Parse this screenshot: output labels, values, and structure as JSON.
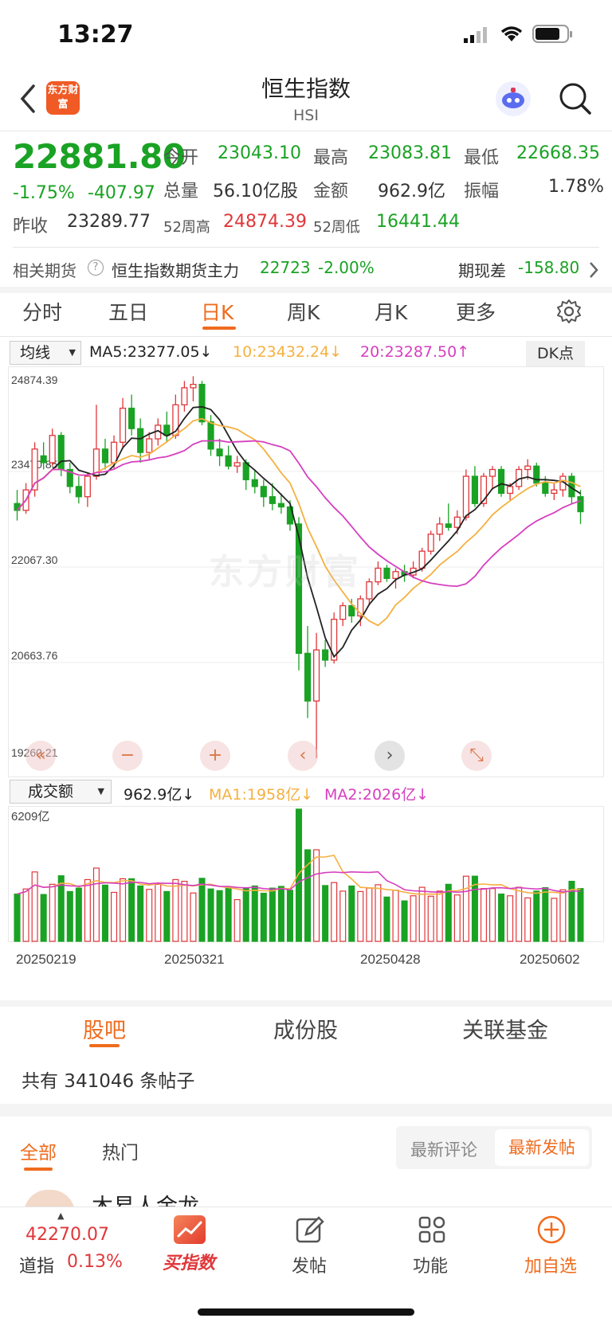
{
  "status": {
    "time": "13:27"
  },
  "header": {
    "title": "恒生指数",
    "subtitle": "HSI",
    "logo_text": "东方财富"
  },
  "quote": {
    "price": "22881.80",
    "change_pct": "-1.75%",
    "change": "-407.97",
    "open_label": "今开",
    "open": "23043.10",
    "high_label": "最高",
    "high": "23083.81",
    "low_label": "最低",
    "low": "22668.35",
    "volume_label": "总量",
    "volume": "56.10亿股",
    "amount_label": "金额",
    "amount": "962.9亿",
    "amplitude_label": "振幅",
    "amplitude": "1.78%",
    "prev_close_label": "昨收",
    "prev_close": "23289.77",
    "wk52_high_label": "52周高",
    "wk52_high": "24874.39",
    "wk52_low_label": "52周低",
    "wk52_low": "16441.44"
  },
  "futures": {
    "label": "相关期货",
    "name": "恒生指数期货主力",
    "price": "22723",
    "pct": "-2.00%",
    "basis_label": "期现差",
    "basis": "-158.80"
  },
  "chart_tabs": [
    "分时",
    "五日",
    "日K",
    "周K",
    "月K",
    "更多"
  ],
  "active_chart_tab": "日K",
  "kline": {
    "indicator_select": "均线",
    "ma5": "MA5:23277.05↓",
    "ma10": "10:23432.24↓",
    "ma20": "20:23287.50↑",
    "dk_button": "DK点",
    "watermark": "东方财富",
    "y_labels": [
      "24874.39",
      "23470.85",
      "22067.30",
      "20663.76",
      "19260.21"
    ],
    "volume_select": "成交额",
    "vol_value": "962.9亿↓",
    "vol_ma1": "MA1:1958亿↓",
    "vol_ma2": "MA2:2026亿↓",
    "vol_max_label": "6209亿",
    "x_labels": [
      "20250219",
      "20250321",
      "20250428",
      "20250602"
    ]
  },
  "chart_data": {
    "type": "candlestick",
    "ylim": [
      19260.21,
      24874.39
    ],
    "colors": {
      "up": "#e0373a",
      "down": "#1aa224",
      "ma5": "#222222",
      "ma10": "#f5b041",
      "ma20": "#d63fbf"
    },
    "candles": [
      [
        23000,
        23200,
        22750,
        22900
      ],
      [
        22900,
        23300,
        22850,
        23200
      ],
      [
        23200,
        23900,
        23100,
        23800
      ],
      [
        23700,
        23900,
        23500,
        23600
      ],
      [
        23600,
        24100,
        23550,
        24000
      ],
      [
        24000,
        24050,
        23400,
        23500
      ],
      [
        23500,
        23600,
        23150,
        23250
      ],
      [
        23250,
        23400,
        23000,
        23100
      ],
      [
        23100,
        23450,
        22950,
        23400
      ],
      [
        23400,
        24450,
        23350,
        23800
      ],
      [
        23800,
        23950,
        23500,
        23600
      ],
      [
        23600,
        24000,
        23500,
        23900
      ],
      [
        23900,
        24550,
        23800,
        24400
      ],
      [
        24400,
        24600,
        24000,
        24100
      ],
      [
        24100,
        24250,
        23600,
        23750
      ],
      [
        23750,
        24050,
        23650,
        23950
      ],
      [
        23950,
        24250,
        23850,
        24150
      ],
      [
        24150,
        24350,
        23900,
        24000
      ],
      [
        24000,
        24600,
        23950,
        24450
      ],
      [
        24450,
        24800,
        24350,
        24700
      ],
      [
        24700,
        24870,
        24500,
        24750
      ],
      [
        24750,
        24800,
        24150,
        24200
      ],
      [
        24200,
        24300,
        23700,
        23800
      ],
      [
        23800,
        23950,
        23550,
        23700
      ],
      [
        23700,
        23850,
        23500,
        23550
      ],
      [
        23550,
        23700,
        23450,
        23600
      ],
      [
        23600,
        23650,
        23200,
        23350
      ],
      [
        23350,
        23500,
        23150,
        23250
      ],
      [
        23250,
        23350,
        22950,
        23100
      ],
      [
        23100,
        23300,
        22900,
        23000
      ],
      [
        23000,
        23150,
        22850,
        22950
      ],
      [
        22950,
        23050,
        22600,
        22700
      ],
      [
        22700,
        22800,
        20550,
        20800
      ],
      [
        20800,
        21200,
        19850,
        20100
      ],
      [
        20100,
        21100,
        19260,
        20850
      ],
      [
        20850,
        21000,
        20600,
        20700
      ],
      [
        20700,
        21400,
        20650,
        21300
      ],
      [
        21300,
        21550,
        21200,
        21500
      ],
      [
        21500,
        21600,
        21250,
        21350
      ],
      [
        21350,
        21650,
        21200,
        21600
      ],
      [
        21600,
        21900,
        21500,
        21850
      ],
      [
        21850,
        22150,
        21800,
        22050
      ],
      [
        22050,
        22100,
        21850,
        21900
      ],
      [
        21900,
        22050,
        21750,
        22000
      ],
      [
        22000,
        22100,
        21850,
        21950
      ],
      [
        21950,
        22150,
        21900,
        22050
      ],
      [
        22050,
        22350,
        22000,
        22300
      ],
      [
        22300,
        22600,
        22250,
        22550
      ],
      [
        22550,
        22800,
        22450,
        22700
      ],
      [
        22700,
        23000,
        22600,
        22650
      ],
      [
        22650,
        22900,
        22550,
        22800
      ],
      [
        22800,
        23500,
        22750,
        23400
      ],
      [
        23400,
        23550,
        22950,
        23000
      ],
      [
        23000,
        23450,
        22950,
        23400
      ],
      [
        23400,
        23550,
        23200,
        23500
      ],
      [
        23500,
        23550,
        23100,
        23150
      ],
      [
        23150,
        23300,
        23050,
        23250
      ],
      [
        23250,
        23550,
        23200,
        23500
      ],
      [
        23500,
        23650,
        23350,
        23550
      ],
      [
        23550,
        23600,
        23250,
        23300
      ],
      [
        23300,
        23400,
        23100,
        23150
      ],
      [
        23150,
        23300,
        23050,
        23200
      ],
      [
        23200,
        23450,
        23100,
        23400
      ],
      [
        23400,
        23450,
        23000,
        23100
      ],
      [
        23100,
        23200,
        22700,
        22880
      ]
    ],
    "volume_max": 6209,
    "x_labels": [
      "20250219",
      "20250321",
      "20250428",
      "20250602"
    ]
  },
  "chart_controls": [
    "«",
    "−",
    "+",
    "‹",
    "›",
    "⤡"
  ],
  "bottom_tabs": [
    "股吧",
    "成份股",
    "关联基金"
  ],
  "active_bottom_tab": "股吧",
  "posts": {
    "count_text": "共有 341046 条帖子",
    "filters": [
      "全部",
      "热门"
    ],
    "sort": [
      "最新评论",
      "最新发帖"
    ],
    "first_author": "木易人金龙"
  },
  "bottombar": {
    "index_value": "42270.07",
    "index_name": "道指",
    "index_pct": "0.13%",
    "buy_index": "买指数",
    "post": "发帖",
    "functions": "功能",
    "add_watch": "加自选"
  }
}
